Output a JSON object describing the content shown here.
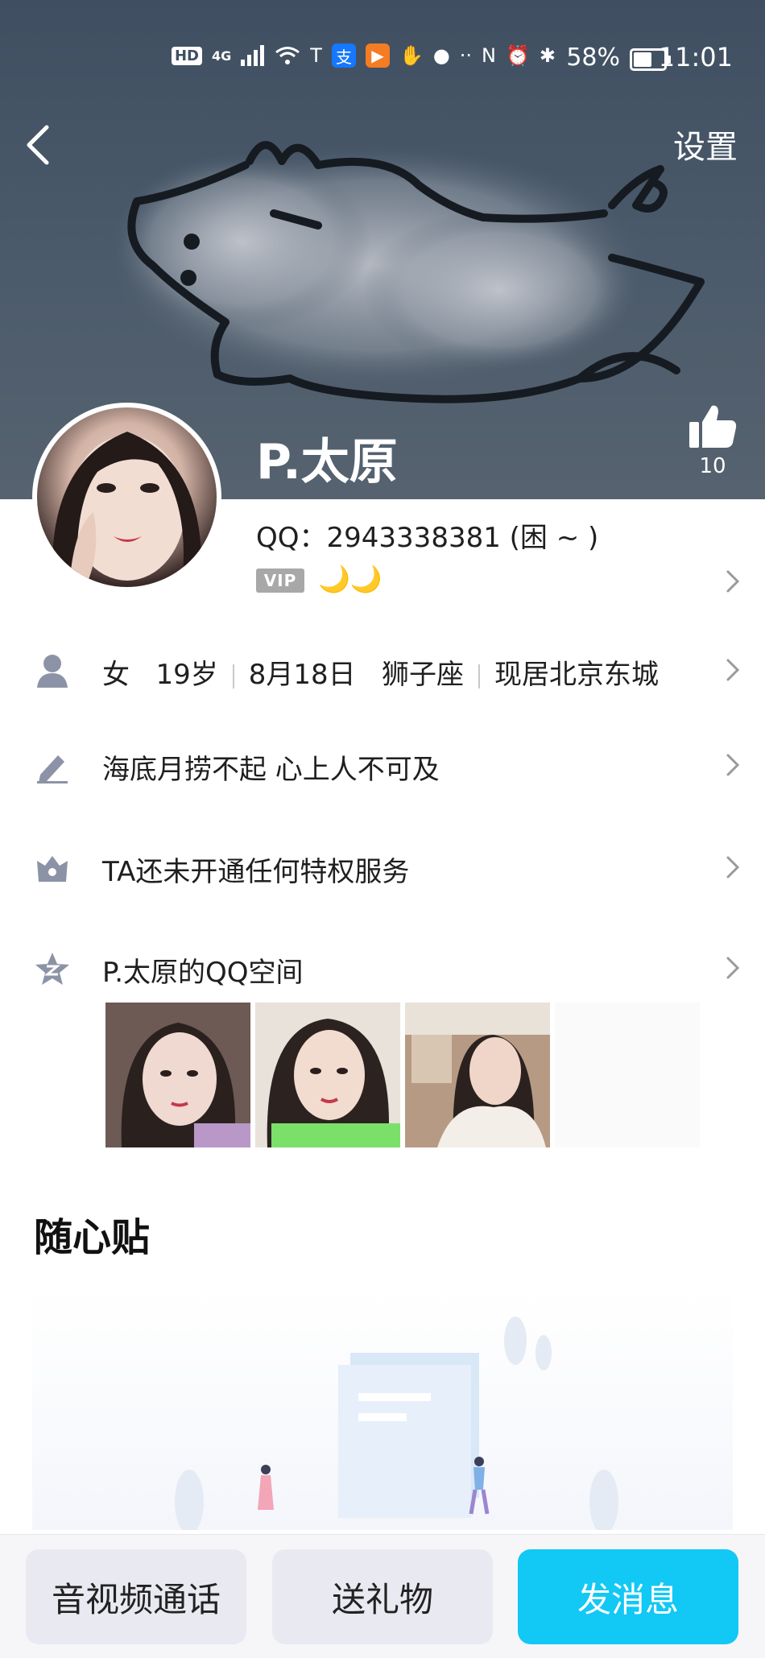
{
  "status_bar": {
    "hd": "HD",
    "network": "4G",
    "battery": "58%",
    "time": "11:01"
  },
  "header": {
    "settings": "设置",
    "likes": "10"
  },
  "profile": {
    "nickname": "P.太原",
    "qq_line": "QQ：2943338381 (困 ~ )",
    "vip": "VIP",
    "moons": "🌙🌙"
  },
  "info": {
    "gender": "女",
    "age": "19岁",
    "birthday": "8月18日",
    "zodiac": "狮子座",
    "location": "现居北京东城"
  },
  "signature": "海底月捞不起 心上人不可及",
  "privilege": "TA还未开通任何特权服务",
  "qzone": "P.太原的QQ空间",
  "section": {
    "title": "随心贴"
  },
  "actions": {
    "call": "音视频通话",
    "gift": "送礼物",
    "message": "发消息"
  },
  "colors": {
    "accent": "#12c8f5",
    "cover": "#4c5b6b",
    "moon": "#e6b521"
  }
}
